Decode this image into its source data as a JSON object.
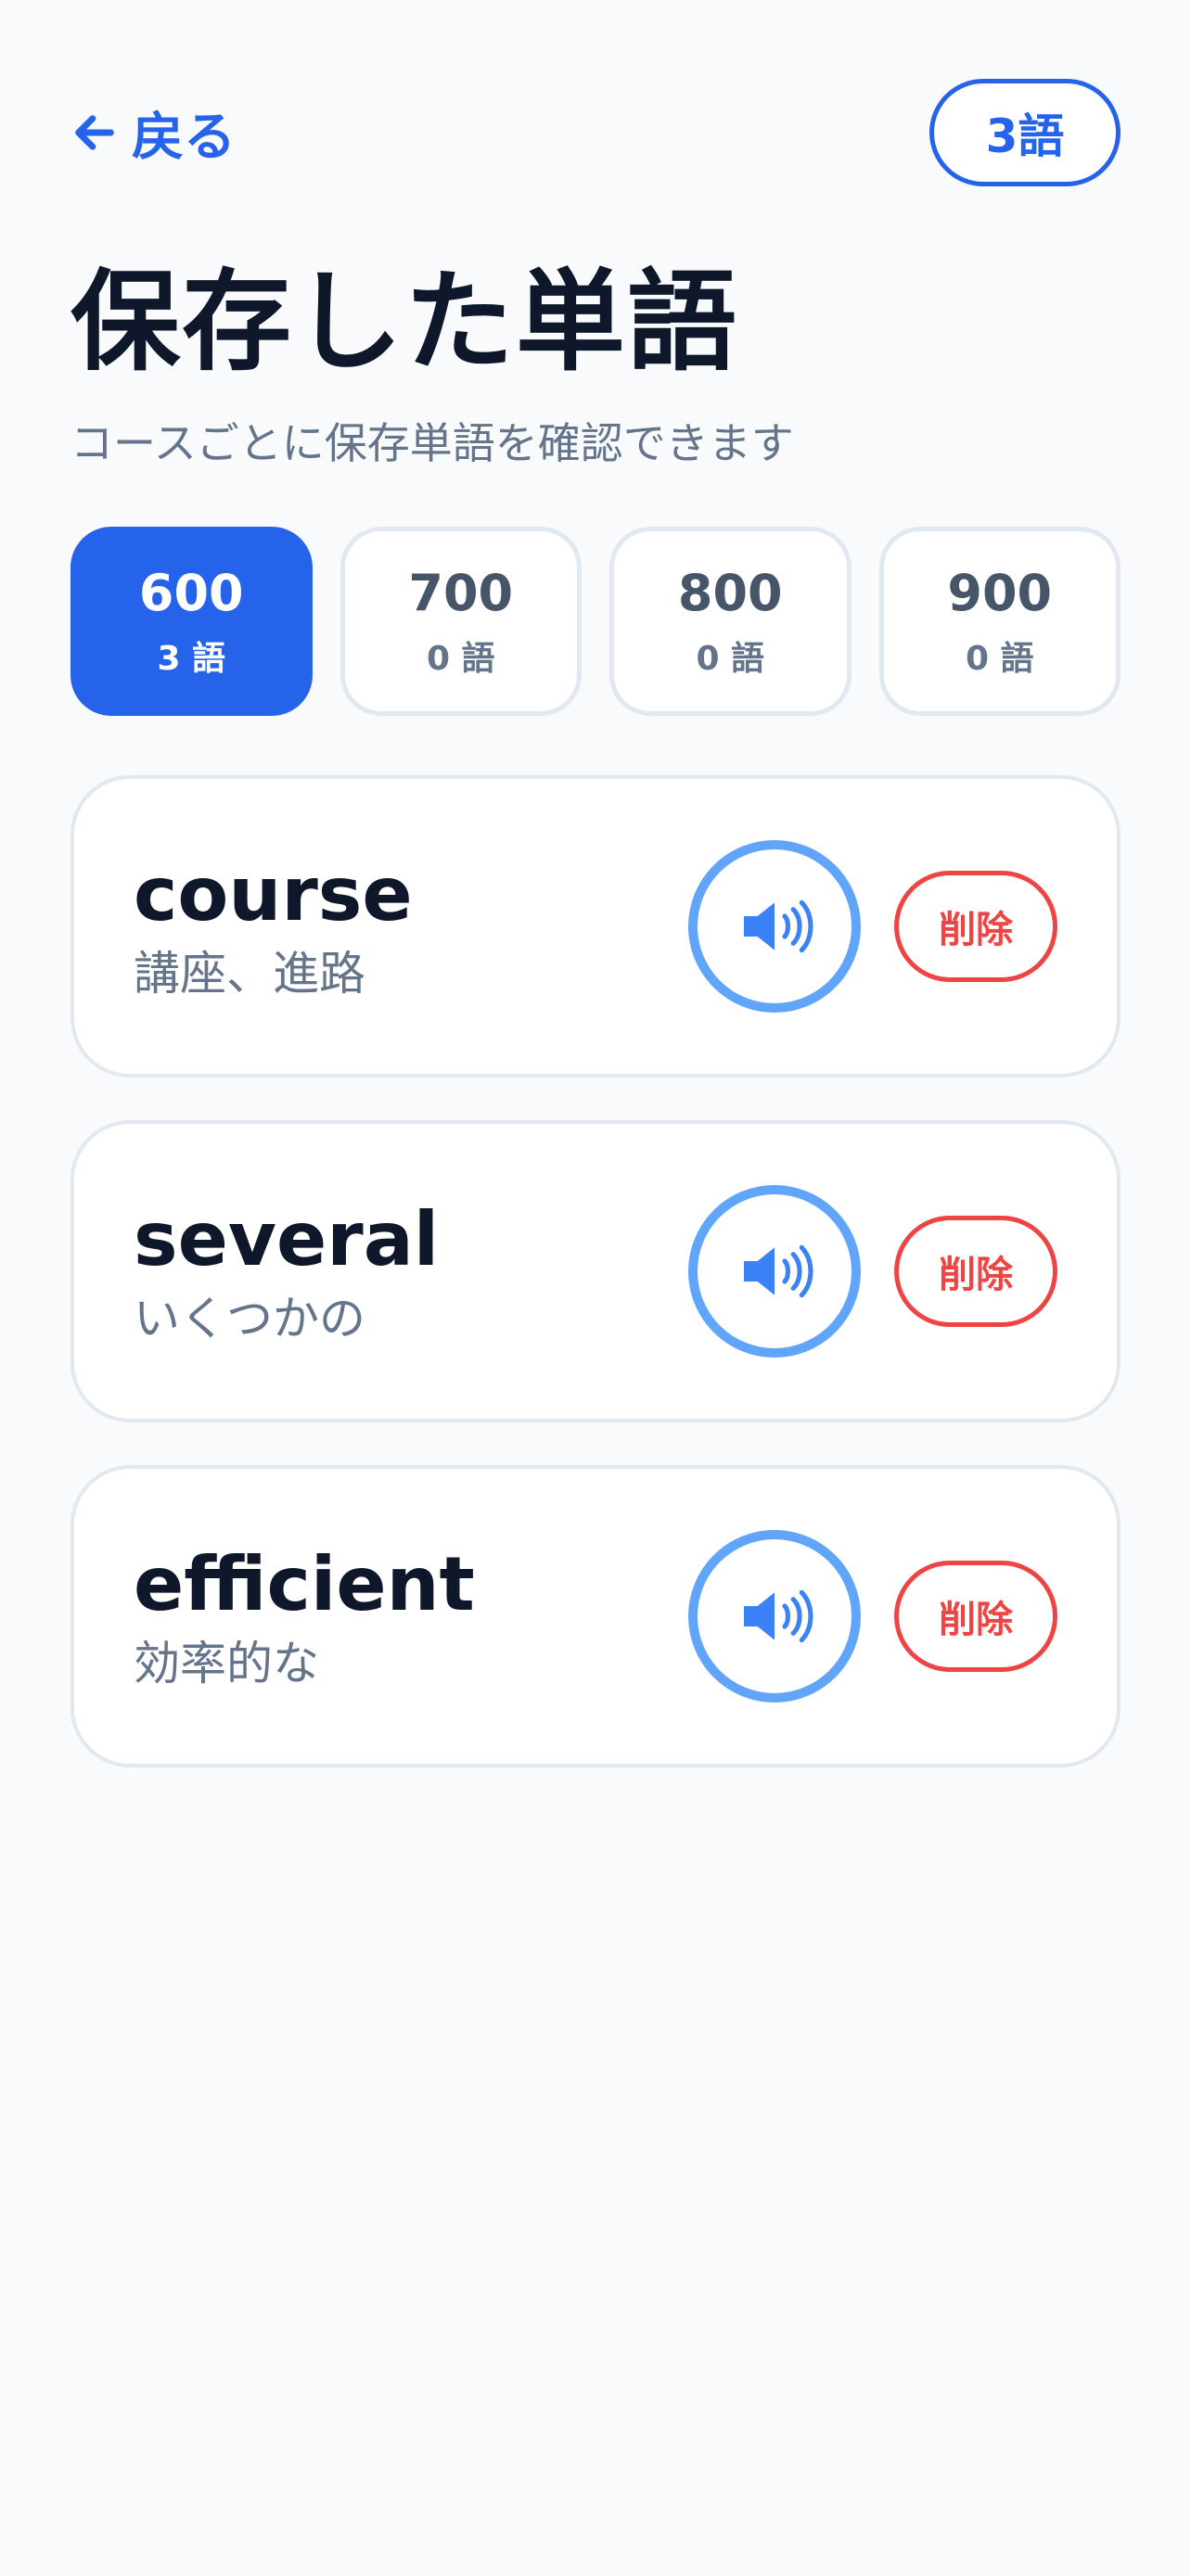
{
  "header": {
    "back_label": "戻る",
    "count_badge": "3語"
  },
  "title": "保存した単語",
  "subtitle": "コースごとに保存単語を確認できます",
  "courses": [
    {
      "level": "600",
      "count": "3 語",
      "active": true
    },
    {
      "level": "700",
      "count": "0 語",
      "active": false
    },
    {
      "level": "800",
      "count": "0 語",
      "active": false
    },
    {
      "level": "900",
      "count": "0 語",
      "active": false
    }
  ],
  "words": [
    {
      "en": "course",
      "ja": "講座、進路",
      "delete_label": "削除"
    },
    {
      "en": "several",
      "ja": "いくつかの",
      "delete_label": "削除"
    },
    {
      "en": "efficient",
      "ja": "効率的な",
      "delete_label": "削除"
    }
  ],
  "icons": {
    "back": "arrow-left-icon",
    "speak": "speaker-icon"
  },
  "colors": {
    "accent": "#2563eb",
    "speaker_ring": "#60a5fa",
    "danger": "#ef4444",
    "text_dark": "#0f172a",
    "text_muted": "#64748b"
  }
}
